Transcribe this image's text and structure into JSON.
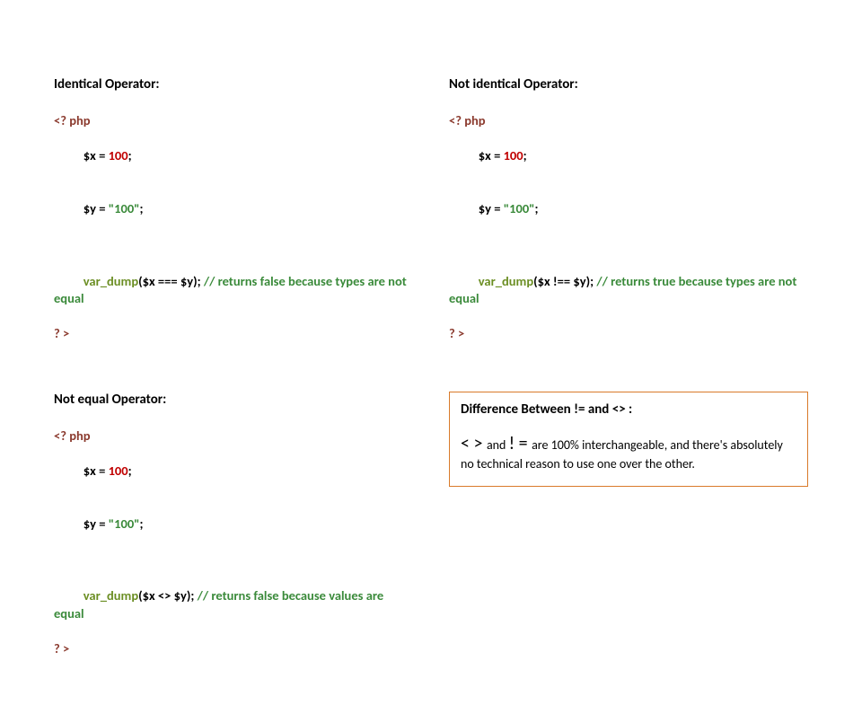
{
  "left": {
    "identical": {
      "heading": "Identical Operator:",
      "open": "<? php",
      "l1a": "$x = ",
      "l1b": "100",
      "l1c": ";",
      "l2a": "$y = ",
      "l2b": "\"100\"",
      "l2c": ";",
      "dump_fn": "var_dump",
      "dump_args_a": "($x === $y); ",
      "dump_comment": "// returns false because types are not equal",
      "close": "? >"
    },
    "notequal": {
      "heading": "Not equal Operator:",
      "open": "<? php",
      "l1a": "$x = ",
      "l1b": "100",
      "l1c": ";",
      "l2a": "$y = ",
      "l2b": "\"100\"",
      "l2c": ";",
      "dump_fn": "var_dump",
      "dump_args_a": "($x <> $y); ",
      "dump_comment": "// returns false because values are equal",
      "close": "? >"
    }
  },
  "right": {
    "notidentical": {
      "heading": "Not identical Operator:",
      "open": "<? php",
      "l1a": "$x = ",
      "l1b": "100",
      "l1c": ";",
      "l2a": "$y = ",
      "l2b": "\"100\"",
      "l2c": ";",
      "dump_fn": "var_dump",
      "dump_args_a": "($x !== $y); ",
      "dump_comment": "// returns true because types are not equal",
      "close": "? >"
    },
    "diff": {
      "heading": "Difference Between != and <> :",
      "sym1": "< > ",
      "mid1": "and ",
      "sym2": "! = ",
      "tail": "are 100% interchangeable, and there's absolutely no technical reason to use one over the other."
    }
  }
}
